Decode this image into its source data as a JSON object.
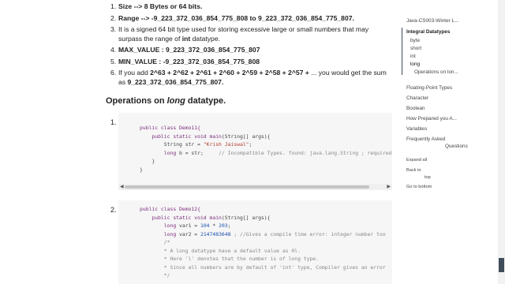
{
  "items": [
    {
      "num": "1.",
      "label": "Size -->",
      "value": "8 Bytes or 64 bits."
    },
    {
      "num": "2.",
      "label": "Range -->",
      "value": "-9_223_372_036_854_775_808 to 9_223_372_036_854_775_807."
    },
    {
      "num": "3.",
      "text_a": "It is a signed 64 bit type used for storing excessive large or small numbers that may surpass the range of",
      "bold": "int",
      "text_b": "datatype."
    },
    {
      "num": "4.",
      "label": "MAX_VALUE : 9_223_372_036_854_775_807"
    },
    {
      "num": "5.",
      "label": "MIN_VALUE : -9_223_372_036_854_775_808"
    },
    {
      "num": "6.",
      "text_a": "If you add",
      "formula": "2^63 + 2^62 + 2^61 + 2^60 + 2^59 + 2^58 + 2^57 +",
      "text_b": "... you would get the sum as",
      "result": "9_223_372_036_854_775_807."
    }
  ],
  "heading": {
    "prefix": "Operations on",
    "italic": "long",
    "suffix": "datatype."
  },
  "code1": {
    "num": "1.",
    "l1_kw": "public class",
    "l1_name": "Demo11{",
    "l2_kw": "public static void",
    "l2_fn": "main",
    "l2_rest": "(String[] args){",
    "l3_a": "String str =",
    "l3_str": "\"Krish Jaiswal\"",
    ";": ";",
    "l4_kw": "long",
    "l4_a": "b = str;",
    "l4_cmt": "// Incompatible Types. found: java.lang.String ; required",
    "l5": "}",
    "l6": "}"
  },
  "code2": {
    "num": "2.",
    "l1_kw": "public class",
    "l1_name": "Demo12{",
    "l2_kw": "public static void",
    "l2_fn": "main",
    "l2_rest": "(String[] args){",
    "l3_kw": "long",
    "l3_a": "var1 =",
    "l3_n1": "104",
    "l3_op": "*",
    "l3_n2": "203",
    "l3_end": ";",
    "l4_kw": "long",
    "l4_a": "var2 =",
    "l4_n": "2147483648",
    "l4_cmt": "; //Gives a compile time error: integer number too",
    "l5": "/*",
    "l6": "* A long datatype have a default value as 0l.",
    "l7": "* Here 'l' denotes that the number is of long type.",
    "l8": "* Since all numbers are by default of 'int' type, Compiler gives an error",
    "l9": "*/"
  },
  "sidebar": {
    "top": "Java-CS003-Winter L...",
    "section": "Integral Datatypes",
    "sub": [
      "byte",
      "short",
      "int",
      "long"
    ],
    "subsub": "Operations on lon...",
    "links": [
      "Floating-Point Types",
      "Character",
      "Boolean",
      "How Prepared you A...",
      "Variables"
    ],
    "fa1": "Frequently Asked",
    "fa2": "Questions",
    "expand": "Expand all",
    "back1": "Back to",
    "back2": "top",
    "bottom": "Go to bottom"
  }
}
